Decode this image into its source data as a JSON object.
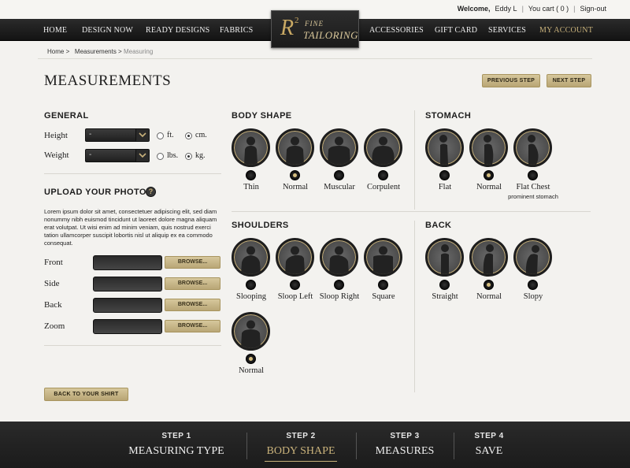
{
  "util": {
    "welcome": "Welcome,",
    "user": "Eddy L",
    "cart": "You cart ( 0 )",
    "signout": "Sign-out"
  },
  "nav": {
    "items": [
      "HOME",
      "DESIGN NOW",
      "READY DESIGNS",
      "FABRICS",
      "ACCESSORIES",
      "GIFT CARD",
      "SERVICES",
      "MY ACCOUNT"
    ],
    "logo": {
      "main": "R",
      "sup": "2",
      "line1": "FINE",
      "line2": "TAILORING"
    }
  },
  "breadcrumb": {
    "home": "Home >",
    "section": "Measurements >",
    "current": "Measuring"
  },
  "page": {
    "title": "MEASUREMENTS",
    "prev_step": "PREVIOUS STEP",
    "next_step": "NEXT STEP",
    "back_to_shirt": "BACK TO YOUR SHIRT"
  },
  "general": {
    "heading": "GENERAL",
    "height_label": "Height",
    "weight_label": "Weight",
    "select_placeholder": "-",
    "height_units": {
      "ft": "ft.",
      "cm": "cm.",
      "selected": "cm."
    },
    "weight_units": {
      "lbs": "lbs.",
      "kg": "kg.",
      "selected": "kg."
    }
  },
  "upload": {
    "heading": "UPLOAD YOUR PHOTO",
    "help": "?",
    "text": "Lorem ipsum dolor sit amet, consectetuer adipiscing elit, sed diam nonummy nibh euismod tincidunt ut laoreet dolore magna aliquam erat volutpat. Ut wisi enim ad minim veniam, quis nostrud exerci tation ullamcorper suscipit lobortis nisl ut aliquip ex ea commodo consequat.",
    "rows": [
      "Front",
      "Side",
      "Back",
      "Zoom"
    ],
    "browse": "BROWSE..."
  },
  "body_shape": {
    "heading": "BODY SHAPE",
    "options": [
      "Thin",
      "Normal",
      "Muscular",
      "Corpulent"
    ],
    "selected": "Normal"
  },
  "stomach": {
    "heading": "STOMACH",
    "options": [
      "Flat",
      "Normal",
      "Flat Chest"
    ],
    "flat_chest_sub": "prominent stomach",
    "selected": "Normal"
  },
  "shoulders": {
    "heading": "SHOULDERS",
    "options": [
      "Slooping",
      "Sloop Left",
      "Sloop Right",
      "Square",
      "Normal"
    ],
    "selected": "Normal"
  },
  "back": {
    "heading": "BACK",
    "options": [
      "Straight",
      "Normal",
      "Slopy"
    ],
    "selected": "Normal"
  },
  "steps": [
    {
      "num": "STEP 1",
      "label": "MEASURING TYPE"
    },
    {
      "num": "STEP 2",
      "label": "BODY SHAPE"
    },
    {
      "num": "STEP 3",
      "label": "MEASURES"
    },
    {
      "num": "STEP 4",
      "label": "SAVE"
    }
  ],
  "active_step": "STEP 2",
  "colors": {
    "gold": "#c9b27b",
    "dark": "#1b1b1b",
    "background": "#f3f2ef"
  }
}
